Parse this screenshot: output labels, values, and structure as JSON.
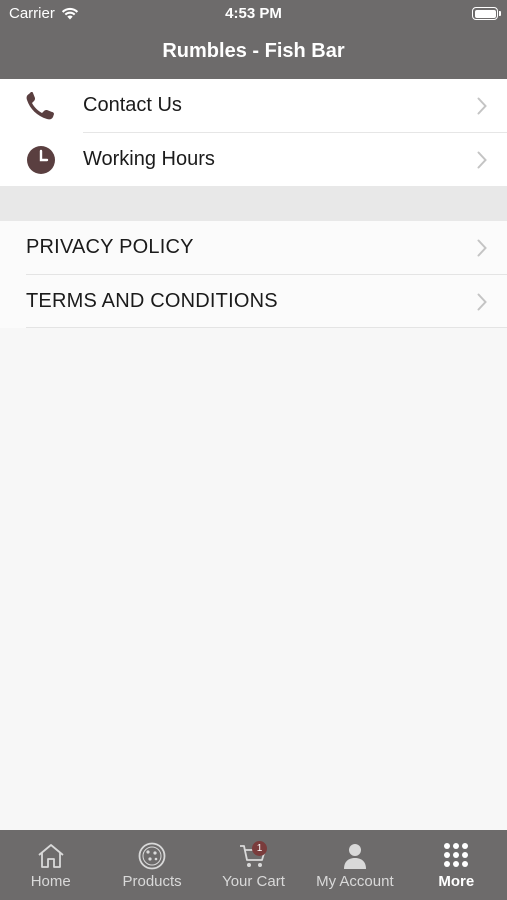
{
  "status_bar": {
    "carrier": "Carrier",
    "time": "4:53 PM"
  },
  "header": {
    "title": "Rumbles - Fish Bar"
  },
  "menu": {
    "items": [
      {
        "label": "Contact Us",
        "icon": "phone-icon"
      },
      {
        "label": "Working Hours",
        "icon": "clock-icon"
      }
    ],
    "legal": [
      {
        "label": "PRIVACY POLICY"
      },
      {
        "label": "TERMS AND CONDITIONS"
      }
    ]
  },
  "tabbar": {
    "tabs": [
      {
        "label": "Home",
        "icon": "home-icon"
      },
      {
        "label": "Products",
        "icon": "pizza-icon"
      },
      {
        "label": "Your Cart",
        "icon": "cart-icon"
      },
      {
        "label": "My Account",
        "icon": "user-icon"
      },
      {
        "label": "More",
        "icon": "grid-icon"
      }
    ],
    "active": "More",
    "cart_badge": "1"
  },
  "colors": {
    "bar": "#6d6b6b",
    "icon": "#5a3f40",
    "badge": "#7a3c3c"
  }
}
